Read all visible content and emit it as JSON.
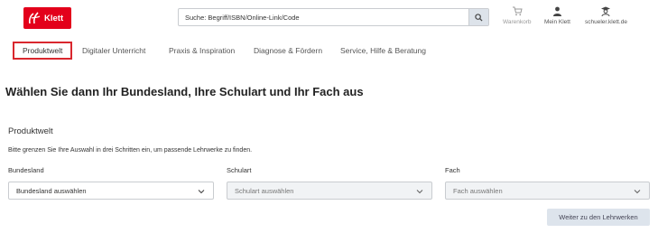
{
  "header": {
    "logo_text": "Klett",
    "search_placeholder": "Suche: Begriff/ISBN/Online-Link/Code",
    "cart_label": "Warenkorb",
    "account_label": "Mein Klett",
    "student_label": "schueler.klett.de"
  },
  "nav": {
    "items": [
      {
        "label": "Produktwelt",
        "active": true
      },
      {
        "label": "Digitaler Unterricht"
      },
      {
        "label": "Praxis & Inspiration"
      },
      {
        "label": "Diagnose & Fördern"
      },
      {
        "label": "Service, Hilfe & Beratung"
      }
    ]
  },
  "main": {
    "title": "Wählen Sie dann Ihr Bundesland, Ihre Schulart und Ihr Fach aus",
    "section_title": "Produktwelt",
    "hint": "Bitte grenzen Sie Ihre Auswahl in drei Schritten ein, um passende Lehrwerke zu finden.",
    "fields": [
      {
        "label": "Bundesland",
        "value": "Bundesland auswählen",
        "disabled": false
      },
      {
        "label": "Schulart",
        "value": "Schulart auswählen",
        "disabled": true
      },
      {
        "label": "Fach",
        "value": "Fach auswählen",
        "disabled": true
      }
    ],
    "submit_label": "Weiter zu den Lehrwerken"
  },
  "colors": {
    "brand": "#e3001b",
    "active_border": "#d9272e",
    "button_bg": "#dde4ec"
  }
}
